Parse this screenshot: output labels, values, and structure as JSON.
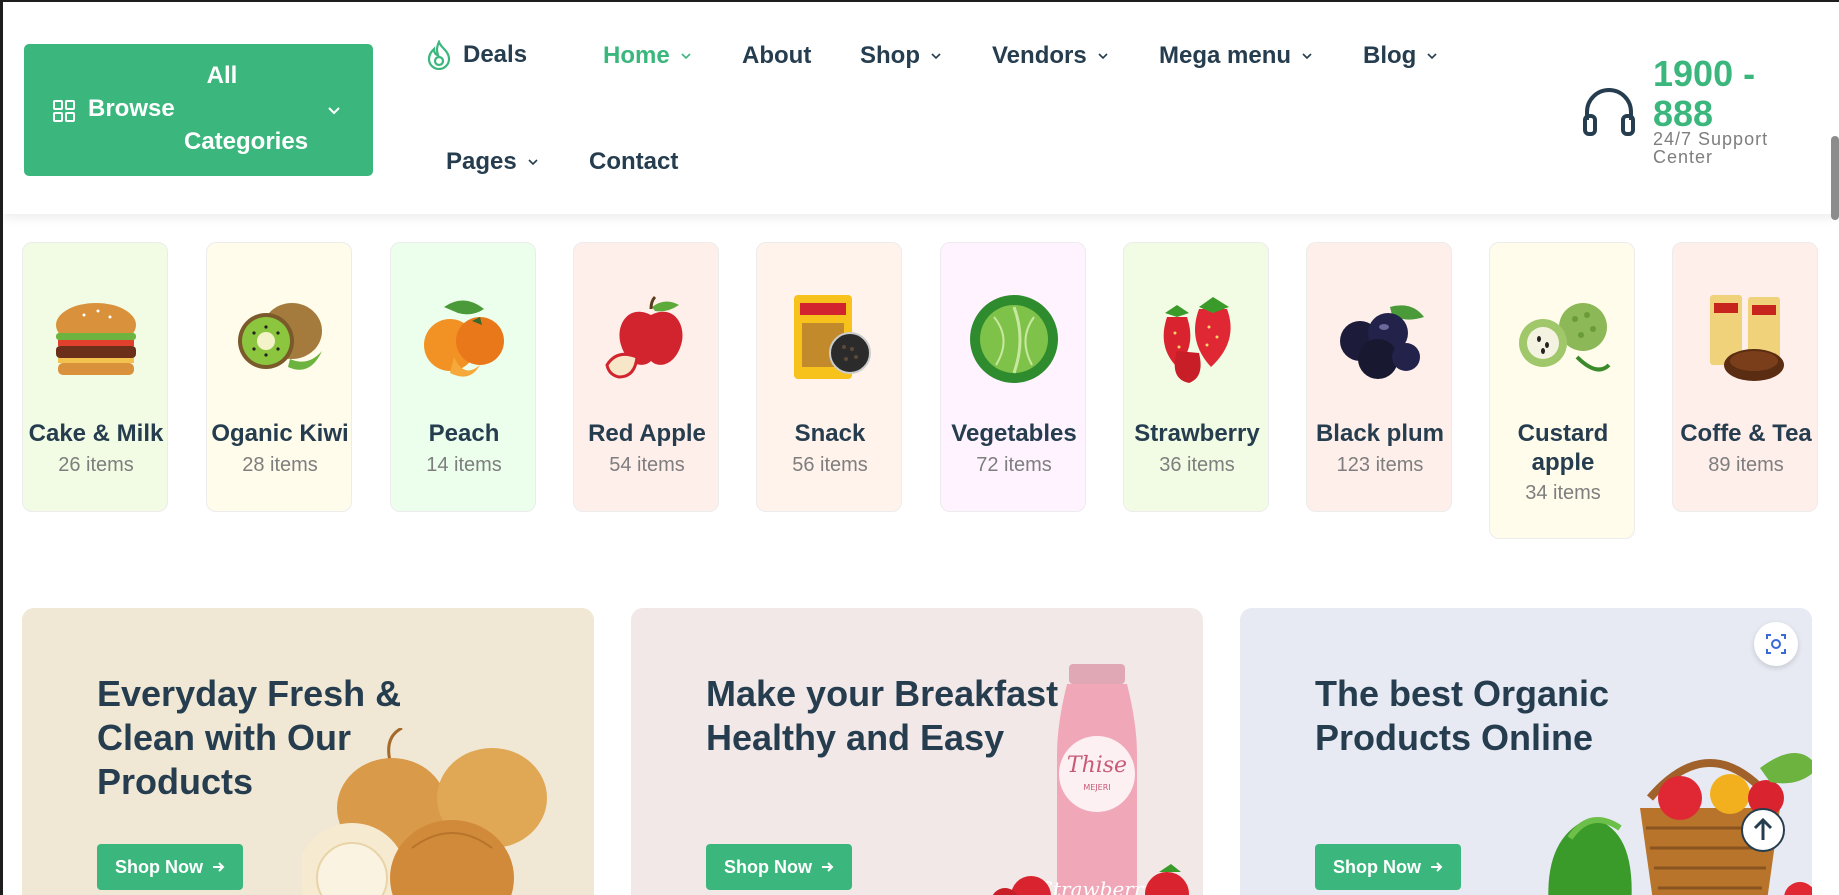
{
  "header": {
    "browse": {
      "line1": "All",
      "browse": "Browse",
      "line3": "Categories"
    },
    "nav": [
      {
        "label": "Deals"
      },
      {
        "label": "Home"
      },
      {
        "label": "About"
      },
      {
        "label": "Shop"
      },
      {
        "label": "Vendors"
      },
      {
        "label": "Mega menu"
      },
      {
        "label": "Blog"
      },
      {
        "label": "Pages"
      },
      {
        "label": "Contact"
      }
    ],
    "support": {
      "phone": "1900 - 888",
      "subtitle": "24/7 Support Center"
    }
  },
  "categories": [
    {
      "name": "Cake & Milk",
      "count": "26 items",
      "bg": "#f2fce4",
      "icon": "burger-icon"
    },
    {
      "name": "Oganic Kiwi",
      "count": "28 items",
      "bg": "#fffceb",
      "icon": "kiwi-icon"
    },
    {
      "name": "Peach",
      "count": "14 items",
      "bg": "#ecffec",
      "icon": "peach-icon"
    },
    {
      "name": "Red Apple",
      "count": "54 items",
      "bg": "#feefea",
      "icon": "apple-icon"
    },
    {
      "name": "Snack",
      "count": "56 items",
      "bg": "#fff3eb",
      "icon": "snack-icon"
    },
    {
      "name": "Vegetables",
      "count": "72 items",
      "bg": "#fff3ff",
      "icon": "cabbage-icon"
    },
    {
      "name": "Strawberry",
      "count": "36 items",
      "bg": "#f2fce4",
      "icon": "strawberry-icon"
    },
    {
      "name": "Black plum",
      "count": "123 items",
      "bg": "#feefea",
      "icon": "plum-icon"
    },
    {
      "name": "Custard apple",
      "count": "34 items",
      "bg": "#fffceb",
      "icon": "custard-apple-icon"
    },
    {
      "name": "Coffe & Tea",
      "count": "89 items",
      "bg": "#feefea",
      "icon": "coffee-tea-icon"
    }
  ],
  "banners": [
    {
      "title": "Everyday Fresh & Clean with Our Products",
      "button": "Shop Now",
      "bg": "#f0e8d5",
      "art": "onion-illustration"
    },
    {
      "title": "Make your Breakfast Healthy and Easy",
      "button": "Shop Now",
      "bg": "#f3e8e8",
      "art": "milk-bottle-illustration"
    },
    {
      "title": "The best Organic Products Online",
      "button": "Shop Now",
      "bg": "#e7eaf3",
      "art": "vegetable-basket-illustration"
    }
  ],
  "bottle_brand": "Thise",
  "bottle_sub": "MEJERI",
  "bottle_label": "Strawberry",
  "colors": {
    "brand": "#3bb77e",
    "heading": "#253d4e",
    "muted": "#7e7e7e"
  }
}
